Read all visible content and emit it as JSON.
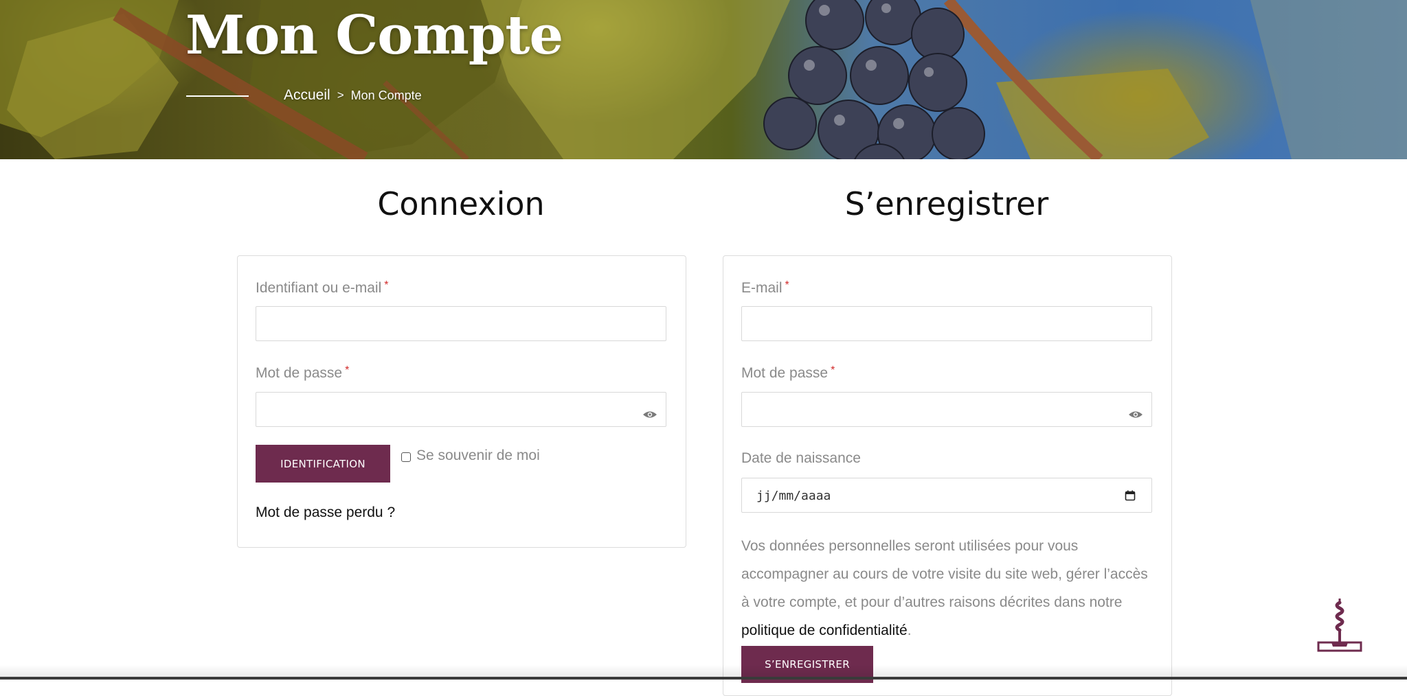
{
  "hero": {
    "title": "Mon Compte",
    "breadcrumb": {
      "home": "Accueil",
      "separator": ">",
      "current": "Mon Compte"
    }
  },
  "login": {
    "title": "Connexion",
    "username_label": "Identifiant ou e-mail",
    "password_label": "Mot de passe",
    "required_mark": "*",
    "submit_label": "IDENTIFICATION",
    "remember_label": "Se souvenir de moi",
    "remember_checked": false,
    "lost_password_link": "Mot de passe perdu ?"
  },
  "register": {
    "title": "S’enregistrer",
    "email_label": "E-mail",
    "password_label": "Mot de passe",
    "required_mark": "*",
    "birthdate_label": "Date de naissance",
    "birthdate_placeholder": "jj/mm/aaaa",
    "privacy_text": "Vos données personnelles seront utilisées pour vous accompagner au cours de votre visite du site web, gérer l’accès à votre compte, et pour d’autres raisons décrites dans notre",
    "privacy_link": "politique de confidentialité",
    "privacy_end": ".",
    "submit_label": "S’ENREGISTRER"
  },
  "colors": {
    "brand": "#6e2b4e",
    "required": "#d12a2a",
    "label": "#8a8a8a",
    "title": "#111111"
  },
  "icons": {
    "password_toggle": "eye-icon",
    "date_picker": "calendar-icon",
    "logo": "corkscrew-logo-icon"
  }
}
